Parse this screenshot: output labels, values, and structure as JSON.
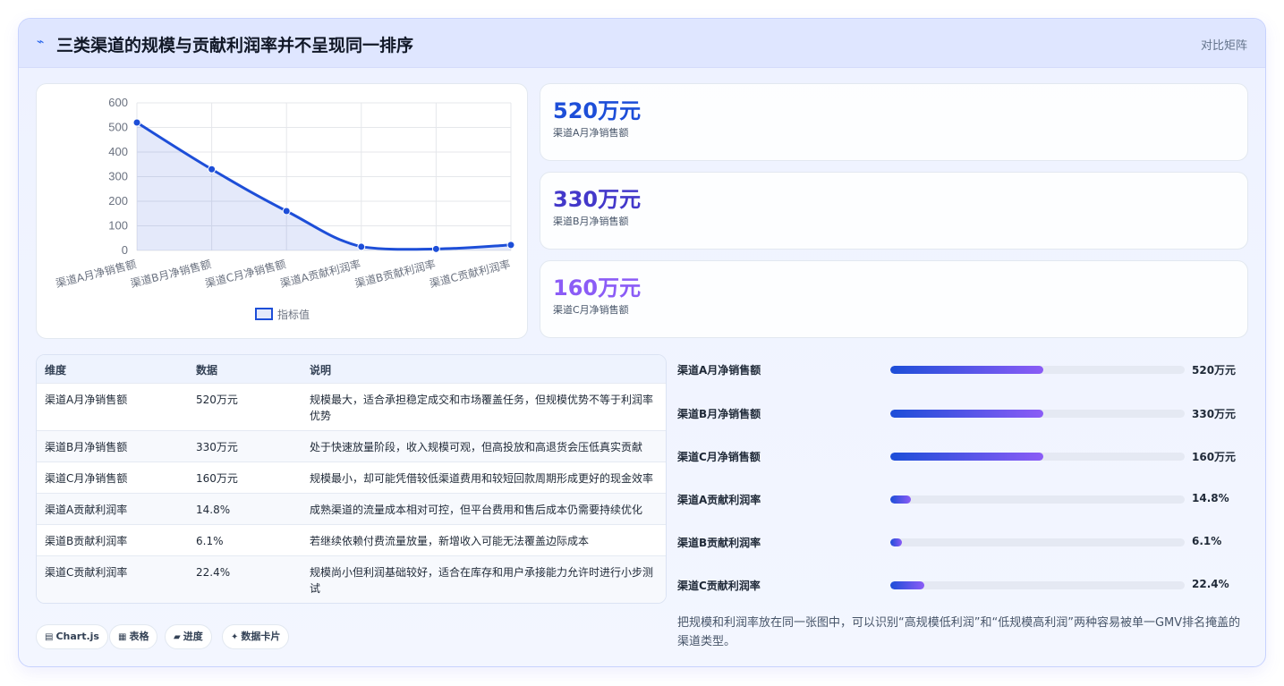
{
  "header": {
    "icon": "lightning-icon",
    "title": "三类渠道的规模与贡献利润率并不呈现同一排序",
    "mode": "对比矩阵"
  },
  "chart_data": {
    "type": "line",
    "categories": [
      "渠道A月净销售额",
      "渠道B月净销售额",
      "渠道C月净销售额",
      "渠道A贡献利润率",
      "渠道B贡献利润率",
      "渠道C贡献利润率"
    ],
    "series": [
      {
        "name": "指标值",
        "values": [
          520,
          330,
          160,
          14.8,
          6.1,
          22.4
        ]
      }
    ],
    "ylim": [
      0,
      600
    ],
    "yticks": [
      0,
      100,
      200,
      300,
      400,
      500,
      600
    ],
    "grid": true,
    "legend": "bottom",
    "colors": {
      "line": "#1d4ed8",
      "fill": "rgba(29,78,216,0.12)"
    }
  },
  "kpis": [
    {
      "value": "520万元",
      "label": "渠道A月净销售额",
      "color": "#1d4ed8"
    },
    {
      "value": "330万元",
      "label": "渠道B月净销售额",
      "color": "#4338ca"
    },
    {
      "value": "160万元",
      "label": "渠道C月净销售额",
      "color": "#8b5cf6"
    }
  ],
  "table": {
    "headers": [
      "维度",
      "数据",
      "说明"
    ],
    "rows": [
      {
        "dim": "渠道A月净销售额",
        "val": "520万元",
        "desc": "规模最大，适合承担稳定成交和市场覆盖任务，但规模优势不等于利润率优势"
      },
      {
        "dim": "渠道B月净销售额",
        "val": "330万元",
        "desc": "处于快速放量阶段，收入规模可观，但高投放和高退货会压低真实贡献"
      },
      {
        "dim": "渠道C月净销售额",
        "val": "160万元",
        "desc": "规模最小，却可能凭借较低渠道费用和较短回款周期形成更好的现金效率"
      },
      {
        "dim": "渠道A贡献利润率",
        "val": "14.8%",
        "desc": "成熟渠道的流量成本相对可控，但平台费用和售后成本仍需要持续优化"
      },
      {
        "dim": "渠道B贡献利润率",
        "val": "6.1%",
        "desc": "若继续依赖付费流量放量，新增收入可能无法覆盖边际成本"
      },
      {
        "dim": "渠道C贡献利润率",
        "val": "22.4%",
        "desc": "规模尚小但利润基础较好，适合在库存和用户承接能力允许时进行小步测试"
      }
    ]
  },
  "bars": [
    {
      "label": "渠道A月净销售额",
      "value": "520万元",
      "fraction": 0.52
    },
    {
      "label": "渠道B月净销售额",
      "value": "330万元",
      "fraction": 0.52
    },
    {
      "label": "渠道C月净销售额",
      "value": "160万元",
      "fraction": 0.52
    },
    {
      "label": "渠道A贡献利润率",
      "value": "14.8%",
      "fraction": 0.07
    },
    {
      "label": "渠道B贡献利润率",
      "value": "6.1%",
      "fraction": 0.04
    },
    {
      "label": "渠道C贡献利润率",
      "value": "22.4%",
      "fraction": 0.115
    }
  ],
  "note": "把规模和利润率放在同一张图中，可以识别“高规模低利润”和“低规模高利润”两种容易被单一GMV排名掩盖的渠道类型。",
  "tags": [
    {
      "icon": "chart-icon",
      "glyph": "▤",
      "label": "Chart.js"
    },
    {
      "icon": "table-icon",
      "glyph": "▦",
      "label": "表格"
    },
    {
      "icon": "progress-icon",
      "glyph": "▰",
      "label": "进度"
    },
    {
      "icon": "sparkle-icon",
      "glyph": "✦",
      "label": "数据卡片"
    }
  ]
}
